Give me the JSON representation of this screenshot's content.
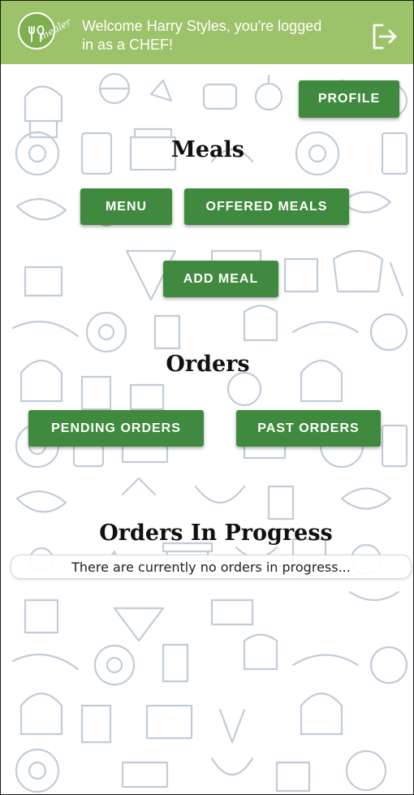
{
  "header": {
    "logo_text": "mealer",
    "welcome_text": "Welcome Harry Styles, you're logged in as a CHEF!",
    "background_color": "#9cc26a",
    "logout_icon": "logout-icon"
  },
  "actions": {
    "profile_label": "PROFILE"
  },
  "meals": {
    "heading": "Meals",
    "menu_label": "MENU",
    "offered_meals_label": "OFFERED MEALS",
    "add_meal_label": "ADD MEAL"
  },
  "orders": {
    "heading": "Orders",
    "pending_orders_label": "PENDING ORDERS",
    "past_orders_label": "PAST ORDERS"
  },
  "in_progress": {
    "heading": "Orders In Progress",
    "empty_message": "There are currently no orders in progress..."
  },
  "colors": {
    "button": "#3f8a3e",
    "button_text": "#ffffff",
    "doodle_stroke": "#8fa3b8"
  }
}
